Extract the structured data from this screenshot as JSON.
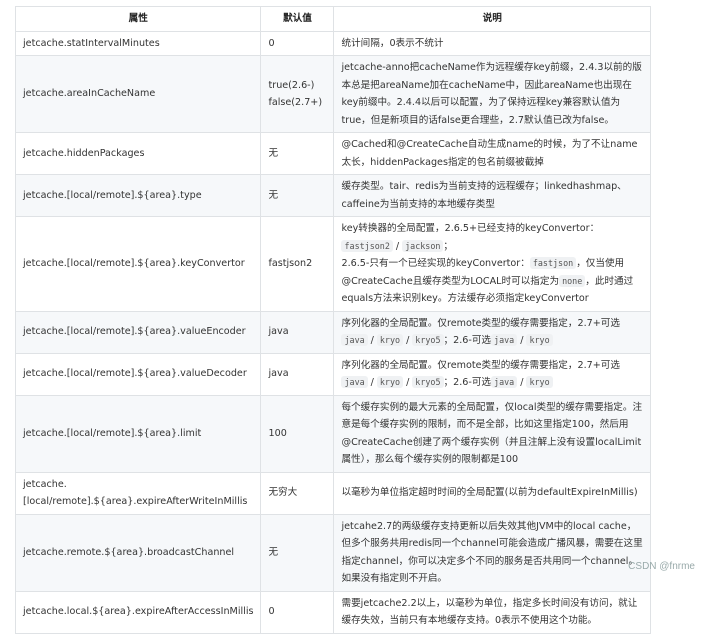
{
  "headers": [
    "属性",
    "默认值",
    "说明"
  ],
  "rows": [
    {
      "prop": "jetcache.statIntervalMinutes",
      "def": "0",
      "desc": "统计间隔，0表示不统计"
    },
    {
      "prop": "jetcache.areaInCacheName",
      "def": "true(2.6-)",
      "def2": "false(2.7+)",
      "desc": "jetcache-anno把cacheName作为远程缓存key前缀，2.4.3以前的版本总是把areaName加在cacheName中，因此areaName也出现在key前缀中。2.4.4以后可以配置，为了保持远程key兼容默认值为true，但是新项目的话false更合理些，2.7默认值已改为false。"
    },
    {
      "prop": "jetcache.hiddenPackages",
      "def": "无",
      "desc": "@Cached和@CreateCache自动生成name的时候，为了不让name太长，hiddenPackages指定的包名前缀被截掉"
    },
    {
      "prop": "jetcache.[local/remote].${area}.type",
      "def": "无",
      "desc": "缓存类型。tair、redis为当前支持的远程缓存；linkedhashmap、caffeine为当前支持的本地缓存类型"
    },
    {
      "prop": "jetcache.[local/remote].${area}.keyConvertor",
      "def": "fastjson2",
      "desc_parts": [
        "key转换器的全局配置，2.6.5+已经支持的keyConvertor：",
        "fastjson2",
        "/",
        "jackson",
        "；",
        "2.6.5-只有一个已经实现的keyConvertor：",
        "fastjson",
        "，仅当使用@CreateCache且缓存类型为LOCAL时可以指定为",
        "none",
        "，此时通过equals方法来识别key。方法缓存必须指定keyConvertor"
      ]
    },
    {
      "prop": "jetcache.[local/remote].${area}.valueEncoder",
      "def": "java",
      "desc_parts": [
        "序列化器的全局配置。仅remote类型的缓存需要指定，2.7+可选",
        "java",
        "/",
        "kryo",
        "/",
        "kryo5",
        "；2.6-可选",
        "java",
        "/",
        "kryo"
      ]
    },
    {
      "prop": "jetcache.[local/remote].${area}.valueDecoder",
      "def": "java",
      "desc_parts": [
        "序列化器的全局配置。仅remote类型的缓存需要指定，2.7+可选",
        "java",
        "/",
        "kryo",
        "/",
        "kryo5",
        "；2.6-可选",
        "java",
        "/",
        "kryo"
      ]
    },
    {
      "prop": "jetcache.[local/remote].${area}.limit",
      "def": "100",
      "desc": "每个缓存实例的最大元素的全局配置，仅local类型的缓存需要指定。注意是每个缓存实例的限制，而不是全部，比如这里指定100，然后用@CreateCache创建了两个缓存实例（并且注解上没有设置localLimit属性），那么每个缓存实例的限制都是100"
    },
    {
      "prop": "jetcache.",
      "prop2": "[local/remote].${area}.expireAfterWriteInMillis",
      "def": "无穷大",
      "desc": "以毫秒为单位指定超时时间的全局配置(以前为defaultExpireInMillis)"
    },
    {
      "prop": "jetcache.remote.${area}.broadcastChannel",
      "def": "无",
      "desc": "jetcahe2.7的两级缓存支持更新以后失效其他JVM中的local cache，但多个服务共用redis同一个channel可能会造成广播风暴，需要在这里指定channel，你可以决定多个不同的服务是否共用同一个channel。如果没有指定则不开启。"
    },
    {
      "prop": "jetcache.local.${area}.expireAfterAccessInMillis",
      "def": "0",
      "desc": "需要jetcache2.2以上，以毫秒为单位，指定多长时间没有访问，就让缓存失效，当前只有本地缓存支持。0表示不使用这个功能。"
    }
  ],
  "watermark": "CSDN @fnrme"
}
